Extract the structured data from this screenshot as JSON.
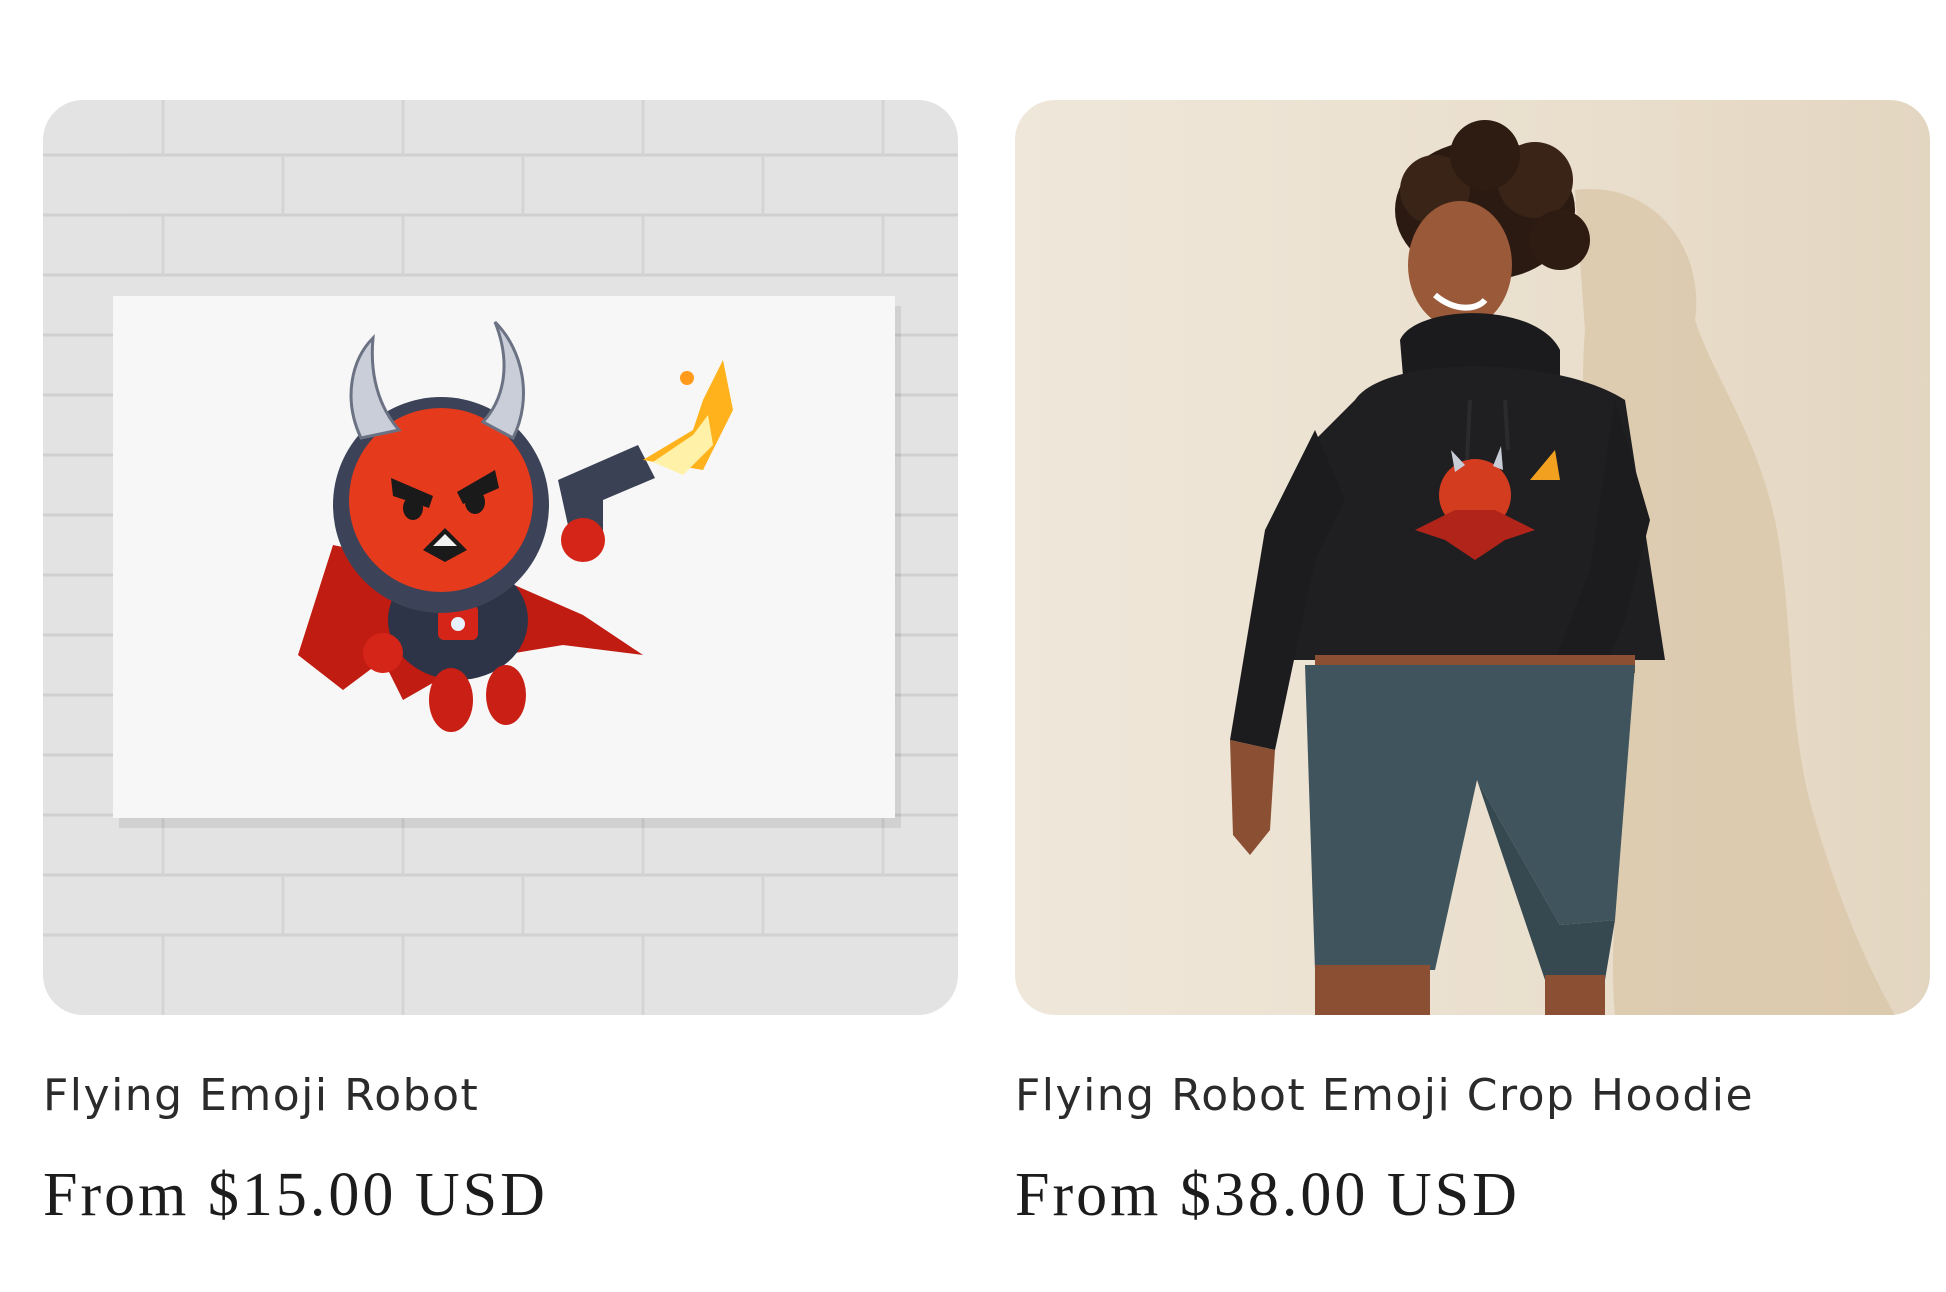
{
  "products": [
    {
      "title": "Flying Emoji Robot",
      "price_prefix": "From",
      "price": "$15.00 USD",
      "image": "devil-robot-canvas-print-image"
    },
    {
      "title": "Flying Robot Emoji Crop Hoodie",
      "price_prefix": "From",
      "price": "$38.00 USD",
      "image": "hoodie-model-image"
    }
  ],
  "colors": {
    "text": "#2b2b2b",
    "price": "#1c1c1c",
    "wall_left": "#e2e2e2",
    "wall_right": "#ece3d4",
    "hoodie": "#1f1f22",
    "shorts": "#3f545c",
    "devil_red": "#e63a1c"
  }
}
